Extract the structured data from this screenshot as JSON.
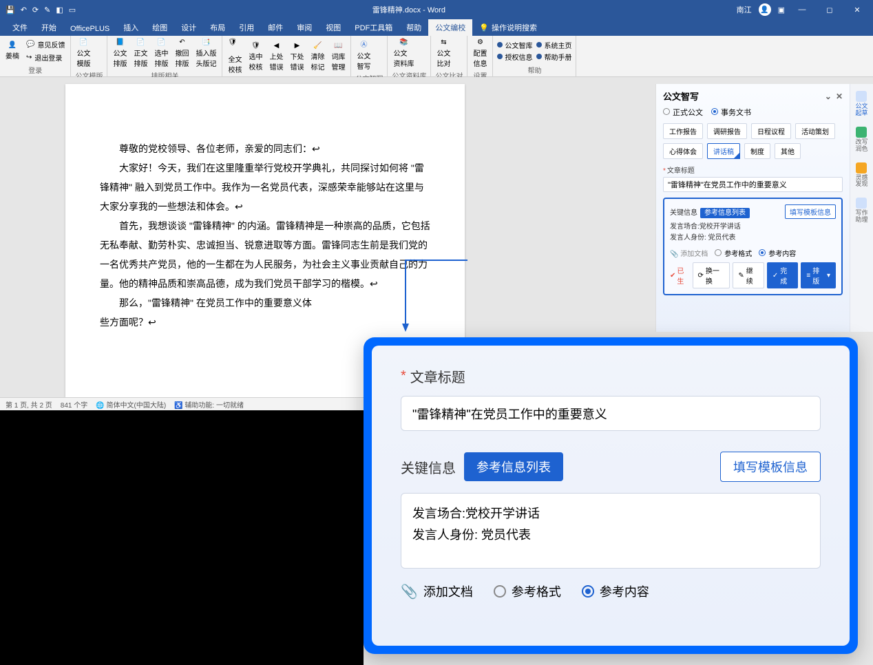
{
  "title_bar": {
    "doc_title": "雷锋精神.docx - Word",
    "user_name": "南江"
  },
  "menu_tabs": [
    "文件",
    "开始",
    "OfficePLUS",
    "插入",
    "绘图",
    "设计",
    "布局",
    "引用",
    "邮件",
    "审阅",
    "视图",
    "PDF工具箱",
    "帮助",
    "公文编校"
  ],
  "active_menu_tab": "公文编校",
  "tell_me": "操作说明搜索",
  "ribbon": {
    "login_group": {
      "label": "登录",
      "user": "姜楠",
      "feedback": "意见反馈",
      "logout": "退出登录"
    },
    "template_group": {
      "label": "公文模版",
      "btn": "公文\n模版"
    },
    "layout_group": {
      "label": "排版相关",
      "btns": [
        "公文\n排版",
        "正文\n排版",
        "选中\n排版",
        "撤回\n排版",
        "插入版\n头版记"
      ]
    },
    "check_group": {
      "label": "公文校核",
      "btns": [
        "全文\n校核",
        "选中\n校核",
        "上处\n错误",
        "下处\n错误",
        "清除\n标记",
        "词库\n管理"
      ]
    },
    "write_group": {
      "label": "公文智写",
      "btn": "公文\n智写"
    },
    "lib_group": {
      "label": "公文资料库",
      "btn": "公文\n资料库"
    },
    "compare_group": {
      "label": "公文比对",
      "btn": "公文\n比对"
    },
    "config_group": {
      "label": "设置",
      "btn": "配置\n信息"
    },
    "admin_group": {
      "label": "帮助",
      "items": [
        "公文智库",
        "授权信息",
        "系统主页",
        "帮助手册"
      ]
    }
  },
  "document": {
    "paragraphs": [
      "尊敬的党校领导、各位老师，亲爱的同志们：↩",
      "大家好！今天，我们在这里隆重举行党校开学典礼，共同探讨如何将 \"雷锋精神\" 融入到党员工作中。我作为一名党员代表，深感荣幸能够站在这里与大家分享我的一些想法和体会。↩",
      "首先，我想谈谈 \"雷锋精神\" 的内涵。雷锋精神是一种崇高的品质，它包括无私奉献、勤劳朴实、忠诚担当、锐意进取等方面。雷锋同志生前是我们党的一名优秀共产党员，他的一生都在为人民服务，为社会主义事业贡献自己的力量。他的精神品质和崇高品德，成为我们党员干部学习的楷模。↩",
      "那么，\"雷锋精神\" 在党员工作中的重要意义体",
      "些方面呢？↩"
    ]
  },
  "statusbar": {
    "page": "第 1 页, 共 2 页",
    "words": "841 个字",
    "lang": "简体中文(中国大陆)",
    "a11y": "辅助功能: 一切就绪"
  },
  "panel": {
    "title": "公文智写",
    "doc_types": {
      "formal": "正式公文",
      "business": "事务文书"
    },
    "tags": [
      "工作报告",
      "调研报告",
      "日程议程",
      "活动策划",
      "心得体会",
      "讲话稿",
      "制度",
      "其他"
    ],
    "active_tag": "讲话稿",
    "article_title_label": "文章标题",
    "article_title_value": "\"雷锋精神\"在党员工作中的重要意义",
    "key_info_label": "关键信息",
    "ref_list_chip": "参考信息列表",
    "fill_template": "填写模板信息",
    "info_line1": "发言场合:党校开学讲话",
    "info_line2": "发言人身份: 党员代表",
    "attach": "添加文档",
    "ref_format": "参考格式",
    "ref_content": "参考内容",
    "generated": "已生",
    "regen": "换一换",
    "continue": "继续",
    "complete": "完成",
    "layout_btn": "排版",
    "side_tabs": [
      {
        "label": "公文\n起草",
        "color": "#1e62d0",
        "active": true
      },
      {
        "label": "改写\n润色",
        "color": "#3cb371"
      },
      {
        "label": "灵感\n发现",
        "color": "#f5a623"
      },
      {
        "label": "写作\n助理",
        "color": "#1e62d0"
      }
    ]
  },
  "zoom": {
    "article_title_label": "文章标题",
    "article_title_value": "\"雷锋精神\"在党员工作中的重要意义",
    "key_info_label": "关键信息",
    "ref_list_chip": "参考信息列表",
    "fill_template": "填写模板信息",
    "info_line1": "发言场合:党校开学讲话",
    "info_line2": "发言人身份: 党员代表",
    "attach": "添加文档",
    "ref_format": "参考格式",
    "ref_content": "参考内容"
  }
}
